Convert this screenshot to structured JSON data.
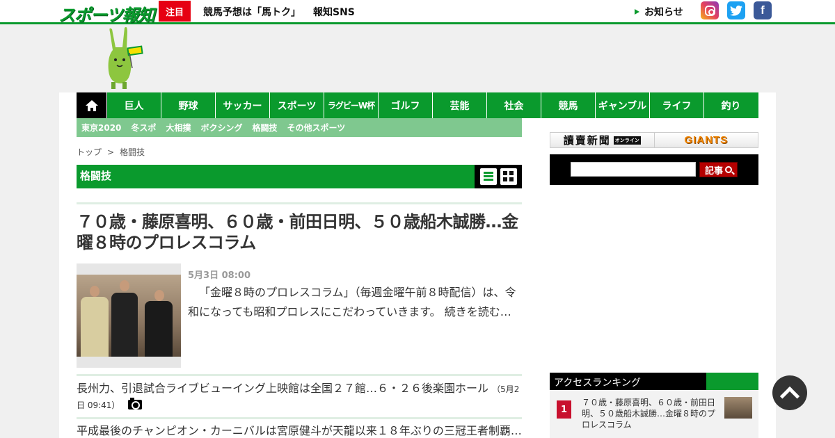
{
  "header": {
    "logo": "スポーツ報知",
    "featured_badge": "注目",
    "links": [
      "競馬予想は「馬トク」",
      "報知SNS"
    ],
    "notice": "お知らせ",
    "social": [
      "instagram-icon",
      "twitter-icon",
      "facebook-icon"
    ],
    "brand_color": "#0a9a2d"
  },
  "nav": {
    "items": [
      "巨人",
      "野球",
      "サッカー",
      "スポーツ",
      "ラグビーW杯",
      "ゴルフ",
      "芸能",
      "社会",
      "競馬",
      "ギャンブル",
      "ライフ",
      "釣り"
    ],
    "sub_items": [
      "東京2020",
      "冬スポ",
      "大相撲",
      "ボクシング",
      "格闘技",
      "その他スポーツ"
    ]
  },
  "breadcrumb": {
    "home": "トップ",
    "separator": ">",
    "current": "格闘技"
  },
  "category": {
    "title": "格闘技"
  },
  "lead": {
    "headline": "７０歳・藤原喜明、６０歳・前田日明、５０歳船木誠勝…金曜８時のプロレスコラム",
    "date": "5月3日 08:00",
    "summary": "「金曜８時のプロレスコラム」（毎週金曜午前８時配信）は、令和になっても昭和プロレスにこだわっていきます。",
    "more": "続きを読む…"
  },
  "articles": [
    {
      "title": "長州力、引退試合ライブビューイング上映館は全国２７館…６・２６後楽園ホール",
      "timestamp": "（5月2日 09:41）",
      "has_photo": true
    },
    {
      "title": "平成最後のチャンピオン・カーニバルは宮原健斗が天龍以来１８年ぶりの三冠王者制覇…",
      "timestamp": "",
      "has_photo": false
    }
  ],
  "sidebar": {
    "partners": [
      "讀賣新聞",
      "GIANTS"
    ],
    "yomiuri_badge": "オンライン",
    "search": {
      "value": "",
      "button_label": "記事"
    },
    "ranking": {
      "title": "アクセスランキング",
      "items": [
        {
          "rank": "1",
          "title": "７０歳・藤原喜明、６０歳・前田日明、５０歳船木誠勝…金曜８時のプロレスコラム"
        }
      ]
    }
  }
}
